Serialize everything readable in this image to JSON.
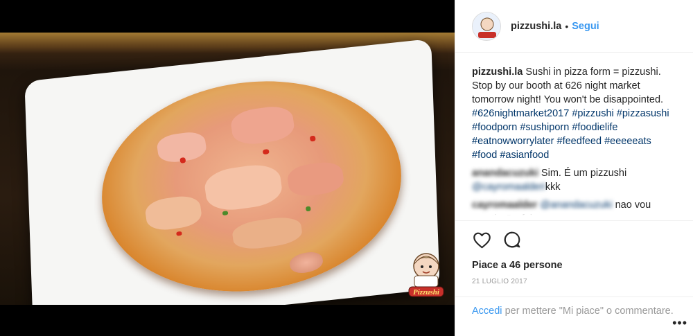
{
  "post": {
    "username": "pizzushi.la",
    "follow_label": "Segui",
    "header_separator": "•",
    "image_alt": "Pizzushi",
    "logo_text": "Pizzushi",
    "caption": {
      "username": "pizzushi.la",
      "text": "Sushi in pizza form = pizzushi. Stop by our booth at 626 night market tomorrow night! You won't be disappointed.",
      "hashtags": [
        "#626nightmarket2017",
        "#pizzushi",
        "#pizzasushi",
        "#foodporn",
        "#sushiporn",
        "#foodielife",
        "#eatnowworrylater",
        "#feedfeed",
        "#eeeeeats",
        "#food",
        "#asianfood"
      ]
    },
    "comments": [
      {
        "username": "anandacuzuki",
        "mention": "",
        "text": "Sim. É um pizzushi",
        "mention_after": "@cayromaalderi",
        "text_after": "kkk"
      },
      {
        "username": "cayromaalder",
        "mention": "@anandacuzuki",
        "text": "nao vou mentir. Gorfei",
        "mention_after": "",
        "text_after": ""
      }
    ],
    "likes_text": "Piace a 46 persone",
    "date": "21 LUGLIO 2017",
    "login": {
      "link": "Accedi",
      "text": "per mettere \"Mi piace\" o commentare."
    },
    "more_label": "•••"
  },
  "icons": {
    "like": "heart-icon",
    "comment": "comment-icon",
    "more": "more-options-icon"
  },
  "colors": {
    "link_blue": "#3897f0",
    "hashtag": "#003569",
    "text": "#262626",
    "muted": "#999999"
  }
}
